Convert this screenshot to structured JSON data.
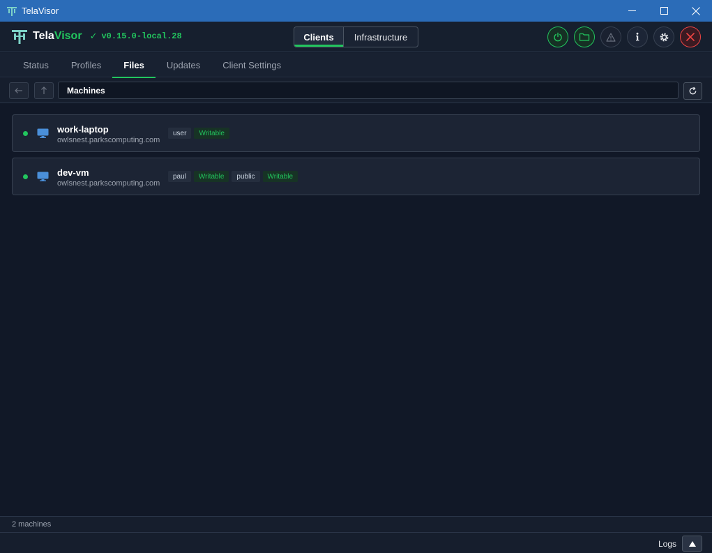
{
  "window": {
    "title": "TelaVisor",
    "controls": [
      "minimize-icon",
      "maximize-icon",
      "close-icon"
    ]
  },
  "header": {
    "brand_a": "Tela",
    "brand_b": "Visor",
    "status_check": "✓",
    "version": "v0.15.0-local.28",
    "segments": [
      {
        "label": "Clients",
        "active": true
      },
      {
        "label": "Infrastructure",
        "active": false
      }
    ],
    "actions": [
      "power-icon",
      "folder-icon",
      "warning-icon",
      "info-icon",
      "gear-icon",
      "close-circle-icon"
    ]
  },
  "tabs": [
    {
      "label": "Status",
      "active": false
    },
    {
      "label": "Profiles",
      "active": false
    },
    {
      "label": "Files",
      "active": true
    },
    {
      "label": "Updates",
      "active": false
    },
    {
      "label": "Client Settings",
      "active": false
    }
  ],
  "pathbar": {
    "back_icon": "arrow-left-icon",
    "up_icon": "arrow-up-icon",
    "path": "Machines",
    "refresh_icon": "refresh-icon"
  },
  "machines": [
    {
      "name": "work-laptop",
      "host": "owlsnest.parkscomputing.com",
      "status": "online",
      "shares": [
        {
          "name": "user",
          "permission": "Writable"
        }
      ]
    },
    {
      "name": "dev-vm",
      "host": "owlsnest.parkscomputing.com",
      "status": "online",
      "shares": [
        {
          "name": "paul",
          "permission": "Writable"
        },
        {
          "name": "public",
          "permission": "Writable"
        }
      ]
    }
  ],
  "status": {
    "count": "2 machines"
  },
  "logs": {
    "label": "Logs",
    "toggle_icon": "triangle-up-icon"
  },
  "colors": {
    "accent": "#22c55e",
    "background": "#111827",
    "titlebar": "#2b6cb8",
    "danger": "#ef4444"
  }
}
